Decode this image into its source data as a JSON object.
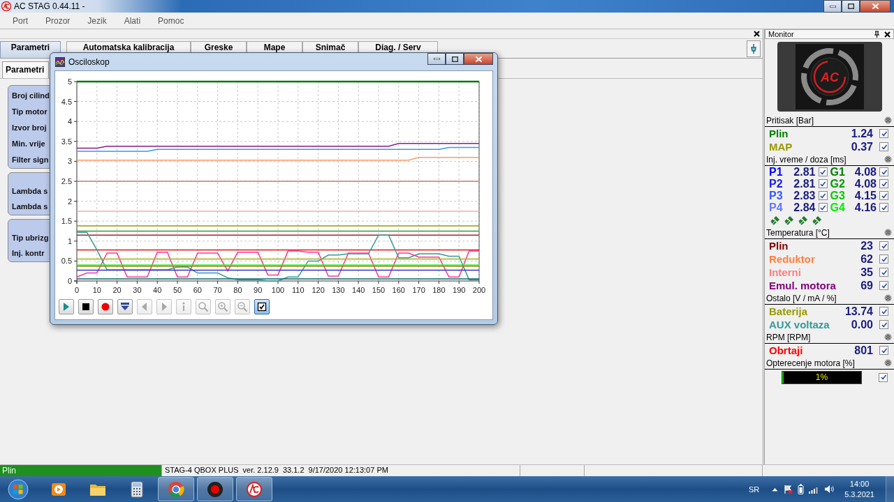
{
  "window": {
    "title": "AC STAG 0.44.11 -"
  },
  "menu": [
    "Port",
    "Prozor",
    "Jezik",
    "Alati",
    "Pomoc"
  ],
  "tabs": [
    {
      "label": "Parametri",
      "selected": true
    },
    {
      "label": "Automatska kalibracija",
      "selected": false
    },
    {
      "label": "Greske",
      "selected": false
    },
    {
      "label": "Mape",
      "selected": false
    },
    {
      "label": "Snimač",
      "selected": false
    },
    {
      "label": "Diag. / Serv",
      "selected": false
    }
  ],
  "subtabs": [
    {
      "label": "Parametri",
      "selected": true
    }
  ],
  "parameter_groups": [
    {
      "labels": [
        "Broj cilind",
        "Tip motor",
        "Izvor broj",
        "Min. vrije",
        "Filter sign"
      ]
    },
    {
      "labels": [
        "Lambda s",
        "Lambda s"
      ]
    },
    {
      "labels": [
        "Tip ubrizg",
        "Inj. kontr"
      ]
    }
  ],
  "oscilloscope": {
    "title": "Osciloskop",
    "chart_data": {
      "type": "line",
      "grid": true,
      "xlim": [
        0,
        200
      ],
      "ylim": [
        0,
        5
      ],
      "xticks": [
        0,
        10,
        20,
        30,
        40,
        50,
        60,
        70,
        80,
        90,
        100,
        110,
        120,
        130,
        140,
        150,
        160,
        170,
        180,
        190,
        200
      ],
      "yticks": [
        0,
        0.5,
        1,
        1.5,
        2,
        2.5,
        3,
        3.5,
        4,
        4.5,
        5
      ],
      "x": [
        0,
        5,
        10,
        15,
        20,
        25,
        30,
        35,
        40,
        45,
        50,
        55,
        60,
        65,
        70,
        75,
        80,
        85,
        90,
        95,
        100,
        105,
        110,
        115,
        120,
        125,
        130,
        135,
        140,
        145,
        150,
        155,
        160,
        165,
        170,
        175,
        180,
        185,
        190,
        195,
        200
      ],
      "series": [
        {
          "color": "#007700",
          "values": [
            5,
            5,
            5,
            5,
            5,
            5,
            5,
            5,
            5,
            5,
            5,
            5,
            5,
            5,
            5,
            5,
            5,
            5,
            5,
            5,
            5,
            5,
            5,
            5,
            5,
            5,
            5,
            5,
            5,
            5,
            5,
            5,
            5,
            5,
            5,
            5,
            5,
            5,
            5,
            5,
            5
          ]
        },
        {
          "color": "#8b1a8b",
          "values": [
            3.33,
            3.33,
            3.33,
            3.38,
            3.38,
            3.38,
            3.38,
            3.38,
            3.38,
            3.38,
            3.38,
            3.38,
            3.38,
            3.38,
            3.38,
            3.38,
            3.38,
            3.38,
            3.38,
            3.38,
            3.38,
            3.38,
            3.38,
            3.38,
            3.38,
            3.38,
            3.38,
            3.38,
            3.38,
            3.38,
            3.38,
            3.38,
            3.45,
            3.45,
            3.45,
            3.45,
            3.45,
            3.45,
            3.45,
            3.45,
            3.45
          ]
        },
        {
          "color": "#3399ee",
          "values": [
            3.25,
            3.25,
            3.25,
            3.25,
            3.25,
            3.25,
            3.25,
            3.25,
            3.3,
            3.3,
            3.3,
            3.3,
            3.3,
            3.3,
            3.3,
            3.3,
            3.3,
            3.3,
            3.3,
            3.3,
            3.3,
            3.3,
            3.3,
            3.3,
            3.3,
            3.3,
            3.3,
            3.3,
            3.3,
            3.3,
            3.3,
            3.3,
            3.3,
            3.3,
            3.3,
            3.3,
            3.3,
            3.35,
            3.35,
            3.35,
            3.35
          ]
        },
        {
          "color": "#ff9966",
          "values": [
            3.03,
            3.03,
            3.03,
            3.03,
            3.03,
            3.03,
            3.03,
            3.03,
            3.03,
            3.03,
            3.03,
            3.03,
            3.03,
            3.03,
            3.03,
            3.03,
            3.03,
            3.03,
            3.03,
            3.03,
            3.03,
            3.03,
            3.03,
            3.03,
            3.03,
            3.03,
            3.03,
            3.03,
            3.03,
            3.03,
            3.03,
            3.03,
            3.03,
            3.03,
            3.1,
            3.1,
            3.1,
            3.1,
            3.1,
            3.1,
            3.1
          ]
        },
        {
          "color": "#cc7a6a",
          "values": [
            2.5,
            2.5,
            2.5,
            2.5,
            2.5,
            2.5,
            2.5,
            2.5,
            2.5,
            2.5,
            2.5,
            2.5,
            2.5,
            2.5,
            2.5,
            2.5,
            2.5,
            2.5,
            2.5,
            2.5,
            2.5,
            2.5,
            2.5,
            2.5,
            2.5,
            2.5,
            2.5,
            2.5,
            2.5,
            2.5,
            2.5,
            2.5,
            2.5,
            2.5,
            2.5,
            2.5,
            2.5,
            2.5,
            2.5,
            2.5,
            2.5
          ]
        },
        {
          "color": "#ffaaaa",
          "values": [
            1.75,
            1.75,
            1.75,
            1.75,
            1.75,
            1.75,
            1.75,
            1.75,
            1.75,
            1.75,
            1.75,
            1.75,
            1.75,
            1.75,
            1.75,
            1.75,
            1.75,
            1.75,
            1.75,
            1.75,
            1.75,
            1.75,
            1.75,
            1.75,
            1.75,
            1.75,
            1.75,
            1.75,
            1.75,
            1.75,
            1.75,
            1.75,
            1.75,
            1.75,
            1.75,
            1.75,
            1.75,
            1.75,
            1.75,
            1.75,
            1.75
          ]
        },
        {
          "color": "#999900",
          "values": [
            1.38,
            1.38,
            1.38,
            1.38,
            1.38,
            1.38,
            1.38,
            1.38,
            1.38,
            1.38,
            1.38,
            1.38,
            1.38,
            1.38,
            1.38,
            1.38,
            1.38,
            1.38,
            1.38,
            1.38,
            1.38,
            1.38,
            1.38,
            1.38,
            1.38,
            1.38,
            1.38,
            1.38,
            1.38,
            1.38,
            1.38,
            1.38,
            1.38,
            1.38,
            1.38,
            1.38,
            1.38,
            1.38,
            1.38,
            1.38,
            1.38
          ]
        },
        {
          "color": "#339933",
          "values": [
            1.25,
            1.25,
            1.25,
            1.25,
            1.25,
            1.25,
            1.25,
            1.25,
            1.25,
            1.25,
            1.25,
            1.25,
            1.25,
            1.25,
            1.25,
            1.25,
            1.25,
            1.25,
            1.25,
            1.25,
            1.25,
            1.25,
            1.25,
            1.25,
            1.25,
            1.25,
            1.25,
            1.25,
            1.25,
            1.25,
            1.25,
            1.25,
            1.25,
            1.25,
            1.25,
            1.25,
            1.25,
            1.25,
            1.25,
            1.25,
            1.25
          ]
        },
        {
          "color": "#aa2222",
          "values": [
            1.15,
            1.15,
            1.15,
            1.15,
            1.15,
            1.15,
            1.15,
            1.15,
            1.15,
            1.15,
            1.15,
            1.15,
            1.15,
            1.15,
            1.15,
            1.15,
            1.15,
            1.15,
            1.15,
            1.15,
            1.15,
            1.15,
            1.15,
            1.15,
            1.15,
            1.15,
            1.15,
            1.15,
            1.15,
            1.15,
            1.15,
            1.15,
            1.15,
            1.15,
            1.15,
            1.15,
            1.15,
            1.15,
            1.15,
            1.15,
            1.15
          ]
        },
        {
          "color": "#ee1111",
          "values": [
            0.78,
            0.78,
            0.78,
            0.78,
            0.78,
            0.78,
            0.78,
            0.78,
            0.78,
            0.78,
            0.78,
            0.78,
            0.78,
            0.78,
            0.78,
            0.78,
            0.78,
            0.78,
            0.78,
            0.78,
            0.78,
            0.78,
            0.78,
            0.78,
            0.78,
            0.78,
            0.78,
            0.78,
            0.78,
            0.78,
            0.78,
            0.78,
            0.78,
            0.78,
            0.78,
            0.78,
            0.78,
            0.78,
            0.78,
            0.78,
            0.78
          ]
        },
        {
          "color": "#ff3399",
          "values": [
            0.1,
            0.2,
            0.2,
            0.7,
            0.7,
            0.1,
            0.1,
            0.1,
            0.72,
            0.72,
            0.1,
            0.1,
            0.7,
            0.7,
            0.7,
            0.25,
            0.72,
            0.72,
            0.72,
            0.15,
            0.15,
            0.75,
            0.75,
            0.72,
            0.72,
            0.12,
            0.12,
            0.7,
            0.7,
            0.7,
            0.1,
            0.1,
            0.7,
            0.7,
            0.6,
            0.6,
            0.6,
            0.1,
            0.1,
            0.75,
            0.75
          ]
        },
        {
          "color": "#339999",
          "values": [
            1.22,
            1.22,
            0.78,
            0.28,
            0.28,
            0.28,
            0.28,
            0.28,
            0.28,
            0.28,
            0.35,
            0.35,
            0.2,
            0.2,
            0.2,
            0.08,
            0.03,
            0.03,
            0.03,
            0,
            0,
            0.1,
            0.1,
            0.5,
            0.5,
            0.65,
            0.65,
            0.68,
            0.68,
            0.68,
            1.15,
            1.15,
            0.58,
            0.58,
            0.68,
            0.68,
            0.68,
            0.62,
            0.62,
            0.03,
            0.03
          ]
        },
        {
          "color": "#aaaa22",
          "values": [
            0.55,
            0.55,
            0.55,
            0.55,
            0.55,
            0.55,
            0.55,
            0.55,
            0.55,
            0.55,
            0.55,
            0.55,
            0.55,
            0.55,
            0.55,
            0.55,
            0.55,
            0.55,
            0.55,
            0.55,
            0.55,
            0.55,
            0.55,
            0.55,
            0.55,
            0.55,
            0.55,
            0.55,
            0.55,
            0.55,
            0.55,
            0.55,
            0.55,
            0.55,
            0.55,
            0.55,
            0.55,
            0.55,
            0.55,
            0.55,
            0.55
          ]
        },
        {
          "color": "#33ee33",
          "values": [
            0.4,
            0.4,
            0.4,
            0.4,
            0.4,
            0.4,
            0.4,
            0.4,
            0.4,
            0.4,
            0.4,
            0.4,
            0.4,
            0.4,
            0.4,
            0.4,
            0.4,
            0.4,
            0.4,
            0.4,
            0.4,
            0.4,
            0.4,
            0.4,
            0.4,
            0.4,
            0.4,
            0.4,
            0.4,
            0.4,
            0.4,
            0.4,
            0.4,
            0.4,
            0.4,
            0.4,
            0.4,
            0.4,
            0.4,
            0.4,
            0.4
          ]
        },
        {
          "color": "#888800",
          "values": [
            0.37,
            0.37,
            0.37,
            0.37,
            0.37,
            0.37,
            0.37,
            0.37,
            0.37,
            0.37,
            0.37,
            0.37,
            0.37,
            0.37,
            0.37,
            0.37,
            0.37,
            0.37,
            0.37,
            0.37,
            0.37,
            0.37,
            0.37,
            0.37,
            0.37,
            0.37,
            0.37,
            0.37,
            0.37,
            0.37,
            0.37,
            0.37,
            0.37,
            0.37,
            0.37,
            0.37,
            0.37,
            0.37,
            0.37,
            0.37,
            0.37
          ]
        },
        {
          "color": "#3333cc",
          "values": [
            0.27,
            0.27,
            0.27,
            0.27,
            0.27,
            0.27,
            0.27,
            0.27,
            0.27,
            0.27,
            0.27,
            0.27,
            0.27,
            0.27,
            0.27,
            0.27,
            0.27,
            0.27,
            0.27,
            0.27,
            0.27,
            0.27,
            0.27,
            0.27,
            0.27,
            0.27,
            0.27,
            0.27,
            0.27,
            0.27,
            0.27,
            0.27,
            0.27,
            0.27,
            0.27,
            0.27,
            0.27,
            0.27,
            0.27,
            0.27,
            0.27
          ]
        },
        {
          "color": "#006666",
          "values": [
            0.05,
            0.05,
            0.05,
            0.05,
            0.05,
            0.05,
            0.05,
            0.05,
            0.05,
            0.05,
            0.05,
            0.05,
            0.05,
            0.05,
            0.05,
            0.05,
            0.05,
            0.05,
            0.05,
            0.05,
            0.05,
            0.05,
            0.05,
            0.05,
            0.05,
            0.05,
            0.05,
            0.05,
            0.05,
            0.05,
            0.05,
            0.05,
            0.05,
            0.05,
            0.05,
            0.05,
            0.05,
            0.05,
            0.05,
            0.05,
            0.05
          ]
        }
      ]
    },
    "toolbar": [
      {
        "kind": "play",
        "disabled": false,
        "selected": false
      },
      {
        "kind": "stop",
        "disabled": false,
        "selected": false
      },
      {
        "kind": "record",
        "disabled": false,
        "selected": false
      },
      {
        "kind": "download",
        "disabled": false,
        "selected": false
      },
      {
        "kind": "previous",
        "disabled": true,
        "selected": false
      },
      {
        "kind": "next",
        "disabled": true,
        "selected": false
      },
      {
        "kind": "info",
        "disabled": true,
        "selected": false
      },
      {
        "kind": "search",
        "disabled": true,
        "selected": false
      },
      {
        "kind": "zoom-in",
        "disabled": true,
        "selected": false
      },
      {
        "kind": "zoom-out",
        "disabled": true,
        "selected": false
      },
      {
        "kind": "checkbox",
        "disabled": false,
        "selected": true
      }
    ]
  },
  "monitor": {
    "title": "Monitor",
    "logo_text": "AC",
    "sections": [
      {
        "title": "Pritisak [Bar]",
        "kind": "values",
        "rows": [
          {
            "label": "Plin",
            "value": "1.24",
            "checked": true,
            "color": "#008000"
          },
          {
            "label": "MAP",
            "value": "0.37",
            "checked": true,
            "color": "#999900"
          }
        ]
      },
      {
        "title": "Inj. vreme / doza [ms]",
        "kind": "injectors",
        "rows": [
          {
            "cells": [
              {
                "label": "P1",
                "value": "2.81",
                "checked": true,
                "color": "#0000ff"
              },
              {
                "label": "G1",
                "value": "4.08",
                "checked": true,
                "color": "#008000"
              }
            ]
          },
          {
            "cells": [
              {
                "label": "P2",
                "value": "2.81",
                "checked": true,
                "color": "#1a1aee"
              },
              {
                "label": "G2",
                "value": "4.08",
                "checked": true,
                "color": "#00a000"
              }
            ]
          },
          {
            "cells": [
              {
                "label": "P3",
                "value": "2.83",
                "checked": true,
                "color": "#3355ff"
              },
              {
                "label": "G3",
                "value": "4.15",
                "checked": true,
                "color": "#00cc00"
              }
            ]
          },
          {
            "cells": [
              {
                "label": "P4",
                "value": "2.84",
                "checked": true,
                "color": "#6677ff"
              },
              {
                "label": "G4",
                "value": "4.16",
                "checked": true,
                "color": "#00ee00"
              }
            ]
          }
        ]
      },
      {
        "title": "Temperatura [°C]",
        "kind": "values",
        "rows": [
          {
            "label": "Plin",
            "value": "23",
            "checked": true,
            "color": "#800000"
          },
          {
            "label": "Reduktor",
            "value": "62",
            "checked": true,
            "color": "#ff8040"
          },
          {
            "label": "Interni",
            "value": "35",
            "checked": true,
            "color": "#ff8080"
          },
          {
            "label": "Emul. motora",
            "value": "69",
            "checked": true,
            "color": "#800080"
          }
        ]
      },
      {
        "title": "Ostalo [V / mA / %]",
        "kind": "values",
        "rows": [
          {
            "label": "Baterija",
            "value": "13.74",
            "checked": true,
            "color": "#999900"
          },
          {
            "label": "AUX voltaza",
            "value": "0.00",
            "checked": true,
            "color": "#339999"
          }
        ]
      },
      {
        "title": "RPM [RPM]",
        "kind": "values",
        "rows": [
          {
            "label": "Obrtaji",
            "value": "801",
            "checked": true,
            "color": "#ff0000"
          }
        ]
      },
      {
        "title": "Opterecenje motora [%]",
        "kind": "gauge",
        "level": 0.01,
        "reading": "1%",
        "checked": true
      }
    ]
  },
  "status_bar": {
    "fuel": "Plin",
    "device": "STAG-4 QBOX PLUS",
    "version": "ver. 2.12.9",
    "firmware": "33.1.2",
    "timestamp": "9/17/2020 12:13:07 PM"
  },
  "taskbar": {
    "apps": [
      {
        "kind": "media",
        "running": false
      },
      {
        "kind": "folder",
        "running": false
      },
      {
        "kind": "calculator",
        "running": false
      },
      {
        "kind": "browser",
        "running": true
      },
      {
        "kind": "recorder",
        "running": true
      },
      {
        "kind": "ac",
        "running": true
      }
    ],
    "language": "SR",
    "time": "14:00",
    "date": "5.3.2021"
  }
}
